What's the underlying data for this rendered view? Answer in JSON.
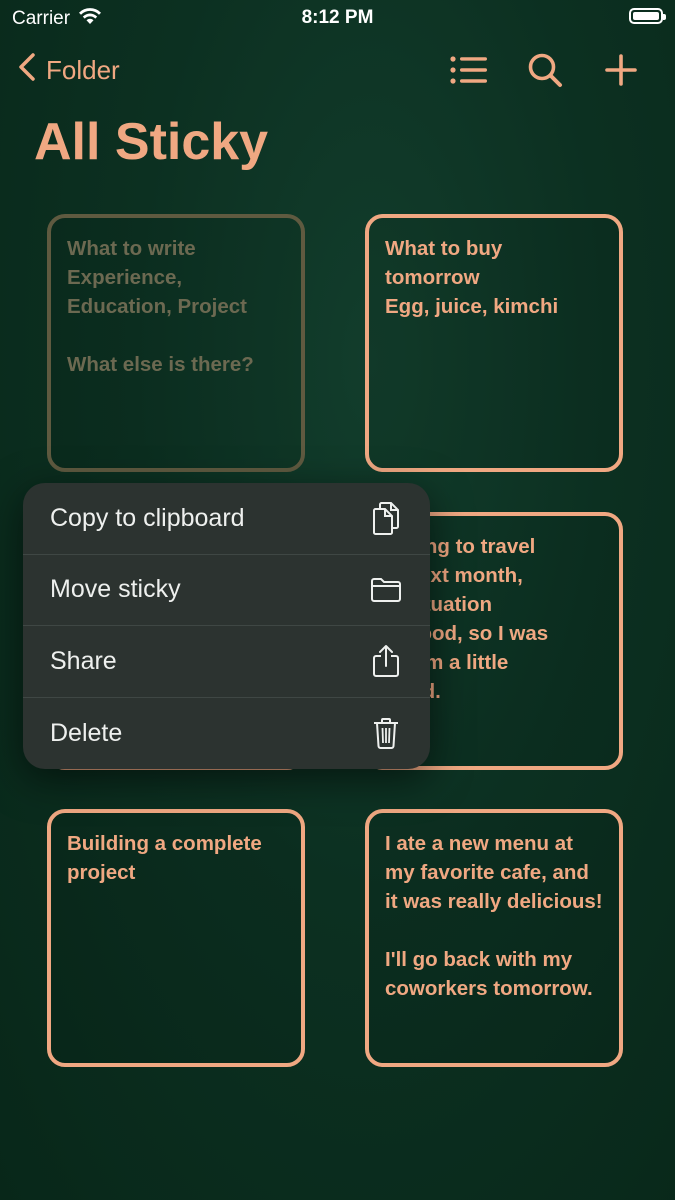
{
  "status_bar": {
    "carrier": "Carrier",
    "time": "8:12 PM"
  },
  "nav": {
    "back_label": "Folder",
    "icons": [
      "chevron-left-icon",
      "list-icon",
      "search-icon",
      "plus-icon"
    ]
  },
  "page": {
    "title": "All Sticky"
  },
  "stickies": [
    {
      "text": "What to write\nExperience,\nEducation, Project\n\nWhat else is there?",
      "state": "dimmed"
    },
    {
      "text": "What to buy\ntomorrow\nEgg, juice, kimchi"
    },
    {
      "text": ""
    },
    {
      "text": "s going to travel\nad next month,\nhe situation\nn't good, so I was\noff. I'm a little\nessed."
    },
    {
      "text": "Building a complete\nproject"
    },
    {
      "text": "I ate a new menu at\nmy favorite cafe, and\nit was really delicious!\n\nI'll go back with my\ncoworkers tomorrow."
    }
  ],
  "context_menu": {
    "items": [
      {
        "label": "Copy to clipboard",
        "icon": "copy-icon"
      },
      {
        "label": "Move sticky",
        "icon": "folder-icon"
      },
      {
        "label": "Share",
        "icon": "share-icon"
      },
      {
        "label": "Delete",
        "icon": "trash-icon"
      }
    ]
  },
  "colors": {
    "accent": "#f0a882",
    "background": "#0c3021",
    "menu": "#2c3330"
  }
}
